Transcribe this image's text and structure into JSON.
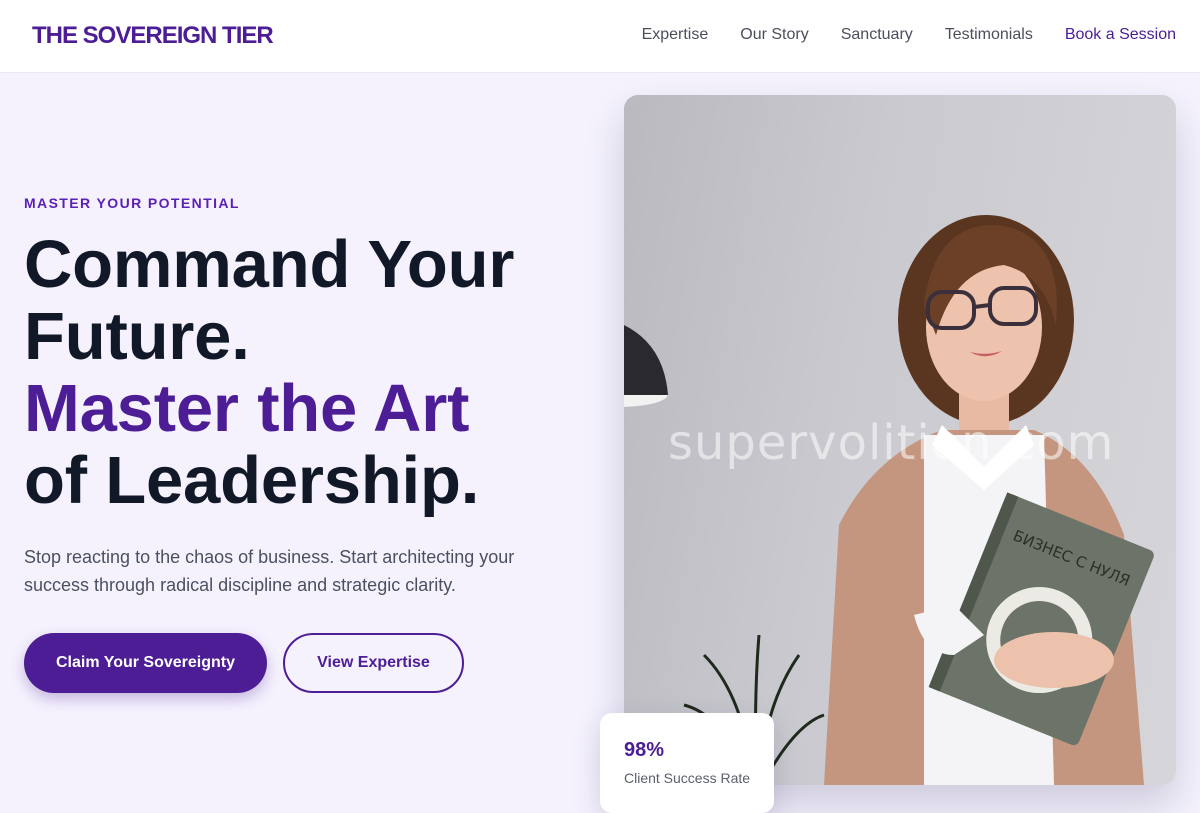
{
  "header": {
    "brand": "THE SOVEREIGN TIER",
    "nav": [
      "Expertise",
      "Our Story",
      "Sanctuary",
      "Testimonials"
    ],
    "cta": "Book a Session"
  },
  "hero": {
    "eyebrow": "MASTER YOUR POTENTIAL",
    "headline_line1": "Command Your",
    "headline_line2": "Future.",
    "headline_accent": "Master the Art",
    "headline_line4": "of Leadership.",
    "subtext": "Stop reacting to the chaos of business. Start architecting your success through radical discipline and strategic clarity.",
    "primary_button": "Claim Your Sovereignty",
    "secondary_button": "View Expertise"
  },
  "image": {
    "watermark": "supervolition.com",
    "book_title": "БИЗНЕС С НУЛЯ"
  },
  "stat": {
    "value": "98%",
    "label": "Client Success Rate"
  },
  "colors": {
    "accent": "#4c1d95",
    "heading": "#111827",
    "background": "#f5f2fe"
  }
}
